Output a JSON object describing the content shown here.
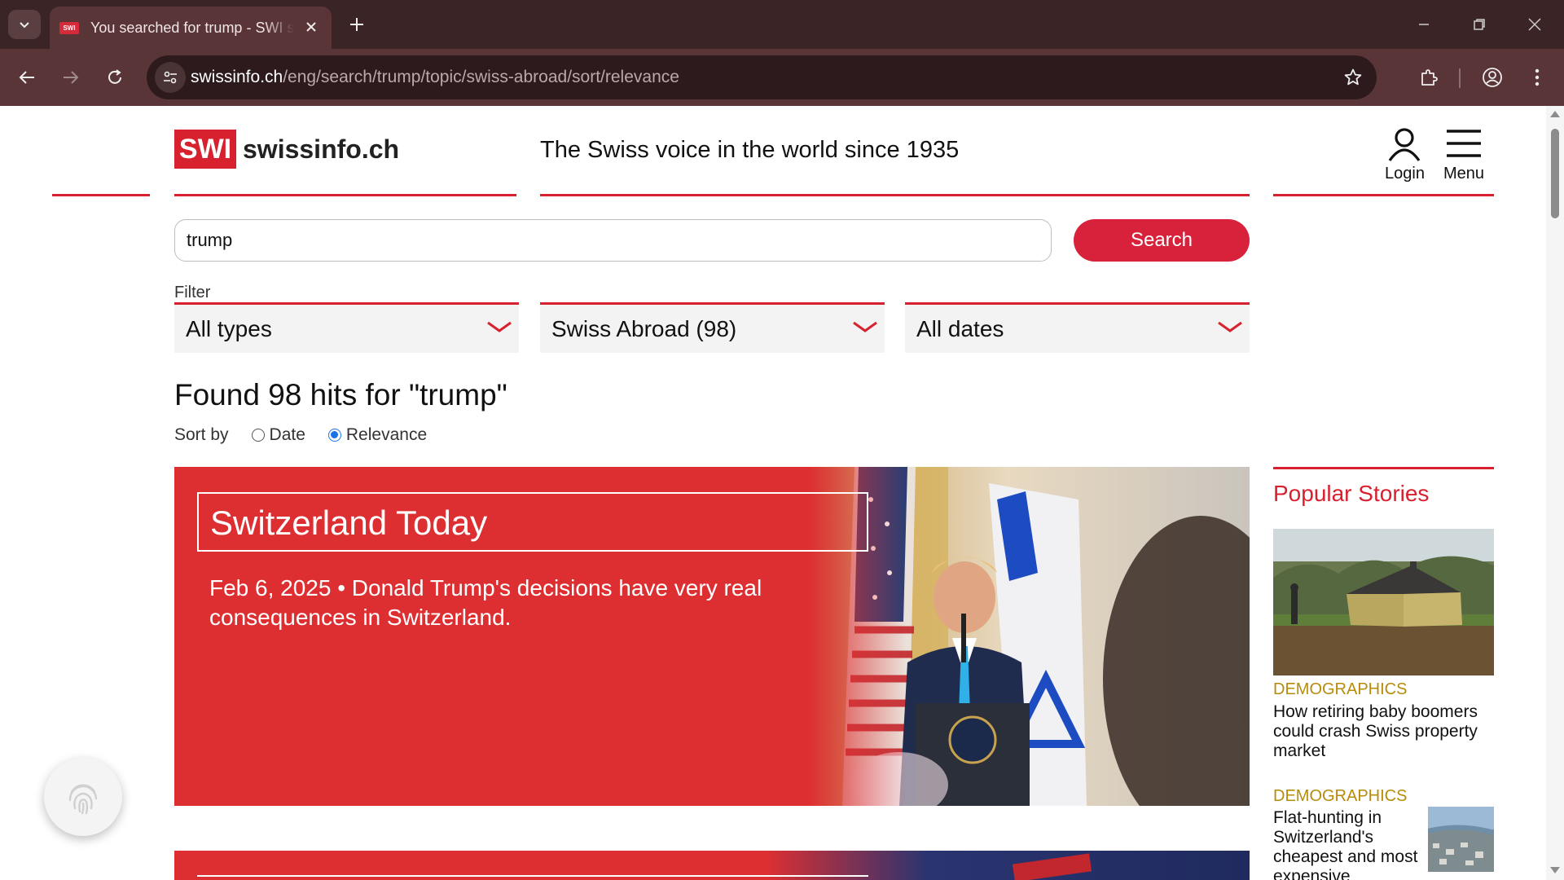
{
  "browser": {
    "tab_title": "You searched for trump - SWI swissinfo.ch",
    "favicon_text": "SWI",
    "url_host": "swissinfo.ch",
    "url_path": "/eng/search/trump/topic/swiss-abroad/sort/relevance"
  },
  "header": {
    "logo_box": "SWI",
    "logo_text": "swissinfo.ch",
    "tagline": "The Swiss voice in the world since 1935",
    "login_label": "Login",
    "menu_label": "Menu"
  },
  "search": {
    "query": "trump",
    "button_label": "Search"
  },
  "filters": {
    "label": "Filter",
    "type": "All types",
    "topic": "Swiss Abroad (98)",
    "date": "All dates"
  },
  "results": {
    "heading": "Found 98 hits for \"trump\"",
    "sort_label": "Sort by",
    "sort_date": "Date",
    "sort_relevance": "Relevance",
    "sort_selected": "Relevance"
  },
  "card": {
    "title": "Switzerland Today",
    "description": "Feb 6, 2025 • Donald Trump's decisions have very real consequences in Switzerland."
  },
  "popular": {
    "title": "Popular Stories",
    "items": [
      {
        "category": "DEMOGRAPHICS",
        "headline": "How retiring baby boomers could crash Swiss property market"
      },
      {
        "category": "DEMOGRAPHICS",
        "headline": "Flat-hunting in Switzerland's cheapest and most expensive"
      }
    ]
  },
  "colors": {
    "brand_red": "#d8212f",
    "card_red": "#dd2f32",
    "category_gold": "#b88c0a",
    "chrome_dark": "#3b2426",
    "chrome_toolbar": "#5a3538"
  },
  "icons": [
    "chevron-down-icon",
    "close-icon",
    "plus-icon",
    "minimize-icon",
    "restore-icon",
    "back-icon",
    "forward-icon",
    "reload-icon",
    "site-info-icon",
    "star-icon",
    "extensions-icon",
    "profile-icon",
    "more-icon",
    "user-icon",
    "hamburger-icon",
    "fingerprint-icon"
  ]
}
